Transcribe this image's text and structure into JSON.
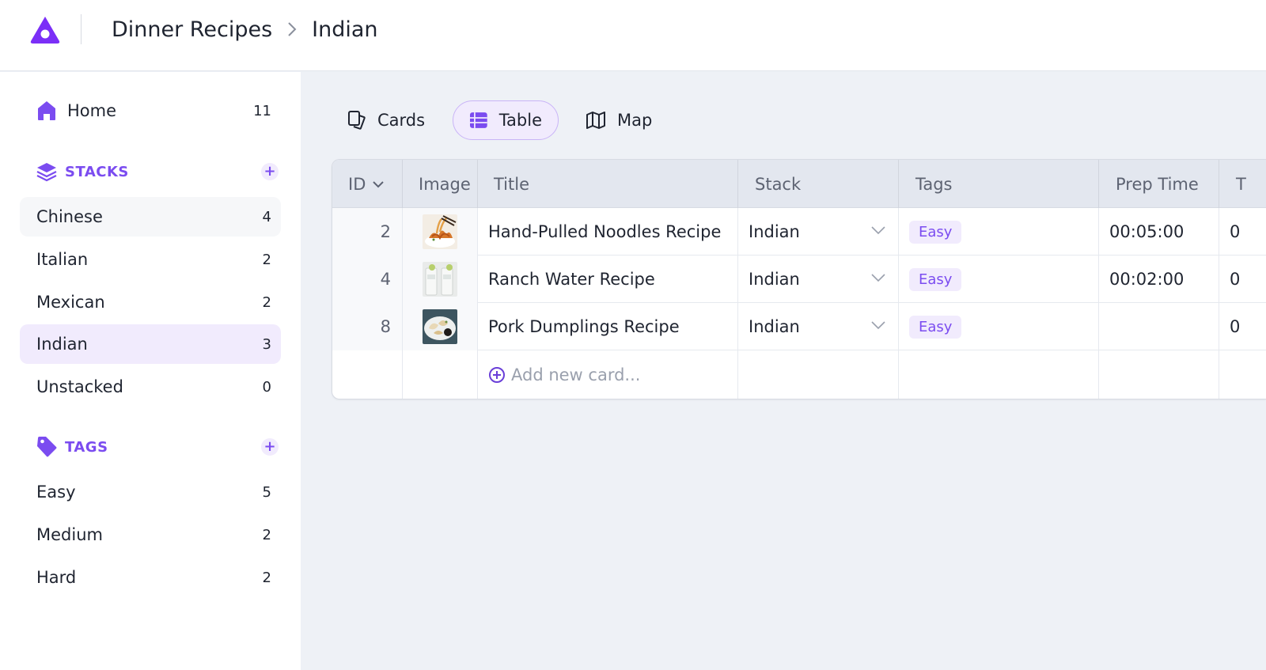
{
  "header": {
    "breadcrumb": [
      "Dinner Recipes",
      "Indian"
    ]
  },
  "sidebar": {
    "home": {
      "label": "Home",
      "count": "11"
    },
    "stacks": {
      "title": "STACKS",
      "items": [
        {
          "label": "Chinese",
          "count": "4"
        },
        {
          "label": "Italian",
          "count": "2"
        },
        {
          "label": "Mexican",
          "count": "2"
        },
        {
          "label": "Indian",
          "count": "3"
        },
        {
          "label": "Unstacked",
          "count": "0"
        }
      ]
    },
    "tags": {
      "title": "TAGS",
      "items": [
        {
          "label": "Easy",
          "count": "5"
        },
        {
          "label": "Medium",
          "count": "2"
        },
        {
          "label": "Hard",
          "count": "2"
        }
      ]
    }
  },
  "views": {
    "cards": "Cards",
    "table": "Table",
    "map": "Map"
  },
  "table": {
    "columns": {
      "id": "ID",
      "image": "Image",
      "title": "Title",
      "stack": "Stack",
      "tags": "Tags",
      "prep_time": "Prep Time",
      "next": "T"
    },
    "rows": [
      {
        "id": "2",
        "title": "Hand-Pulled Noodles Recipe",
        "stack": "Indian",
        "tag": "Easy",
        "prep_time": "00:05:00",
        "next": "0"
      },
      {
        "id": "4",
        "title": "Ranch Water Recipe",
        "stack": "Indian",
        "tag": "Easy",
        "prep_time": "00:02:00",
        "next": "0"
      },
      {
        "id": "8",
        "title": "Pork Dumplings Recipe",
        "stack": "Indian",
        "tag": "Easy",
        "prep_time": "",
        "next": "0"
      }
    ],
    "add_label": "Add new card..."
  },
  "colors": {
    "accent": "#7b4cf0",
    "accent_light": "#f1ebfd",
    "bg": "#eef1f6"
  }
}
